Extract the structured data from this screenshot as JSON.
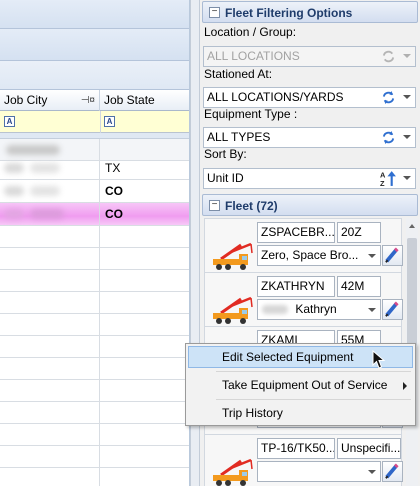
{
  "grid": {
    "columns": [
      "Job City",
      "Job State"
    ],
    "filter_icon_glyph": "A",
    "rows": [
      {
        "state": "",
        "style": "blurred-gray"
      },
      {
        "state": "TX",
        "style": "normal"
      },
      {
        "state": "CO",
        "style": "bold"
      },
      {
        "state": "CO",
        "style": "bold-highlighted"
      }
    ],
    "highlight_color": "#f09cf0"
  },
  "panel": {
    "filter_section_title": "Fleet Filtering Options",
    "location_label": "Location / Group:",
    "location_value": "ALL LOCATIONS",
    "stationed_label": "Stationed At:",
    "stationed_value": "ALL LOCATIONS/YARDS",
    "equipment_type_label": "Equipment Type :",
    "equipment_type_value": "ALL TYPES",
    "sort_label": "Sort By:",
    "sort_value": "Unit ID",
    "fleet_section_title": "Fleet (72)",
    "collapse_glyph": "−"
  },
  "fleet": [
    {
      "unit": "ZSPACEBR...",
      "size": "20Z",
      "operator": "Zero, Space Bro..."
    },
    {
      "unit": "ZKATHRYN",
      "size": "42M",
      "operator": "Kathryn"
    },
    {
      "unit": "ZKAMI",
      "size": "55M",
      "operator": ""
    },
    {
      "unit": "",
      "size": "",
      "operator": ""
    },
    {
      "unit": "TP-16/TK50...",
      "size": "Unspecifi...",
      "operator": ""
    }
  ],
  "context_menu": {
    "items": [
      {
        "label": "Edit Selected Equipment",
        "highlighted": true,
        "submenu": false
      },
      {
        "label": "Take Equipment Out of Service",
        "highlighted": false,
        "submenu": true
      },
      {
        "label": "Trip History",
        "highlighted": false,
        "submenu": false
      }
    ]
  },
  "colors": {
    "accent": "#1f3c6b",
    "menu_highlight": "#cde3f7",
    "filter_row": "#ffffd4",
    "truck_orange": "#f39a1e",
    "truck_red": "#e12b22"
  }
}
